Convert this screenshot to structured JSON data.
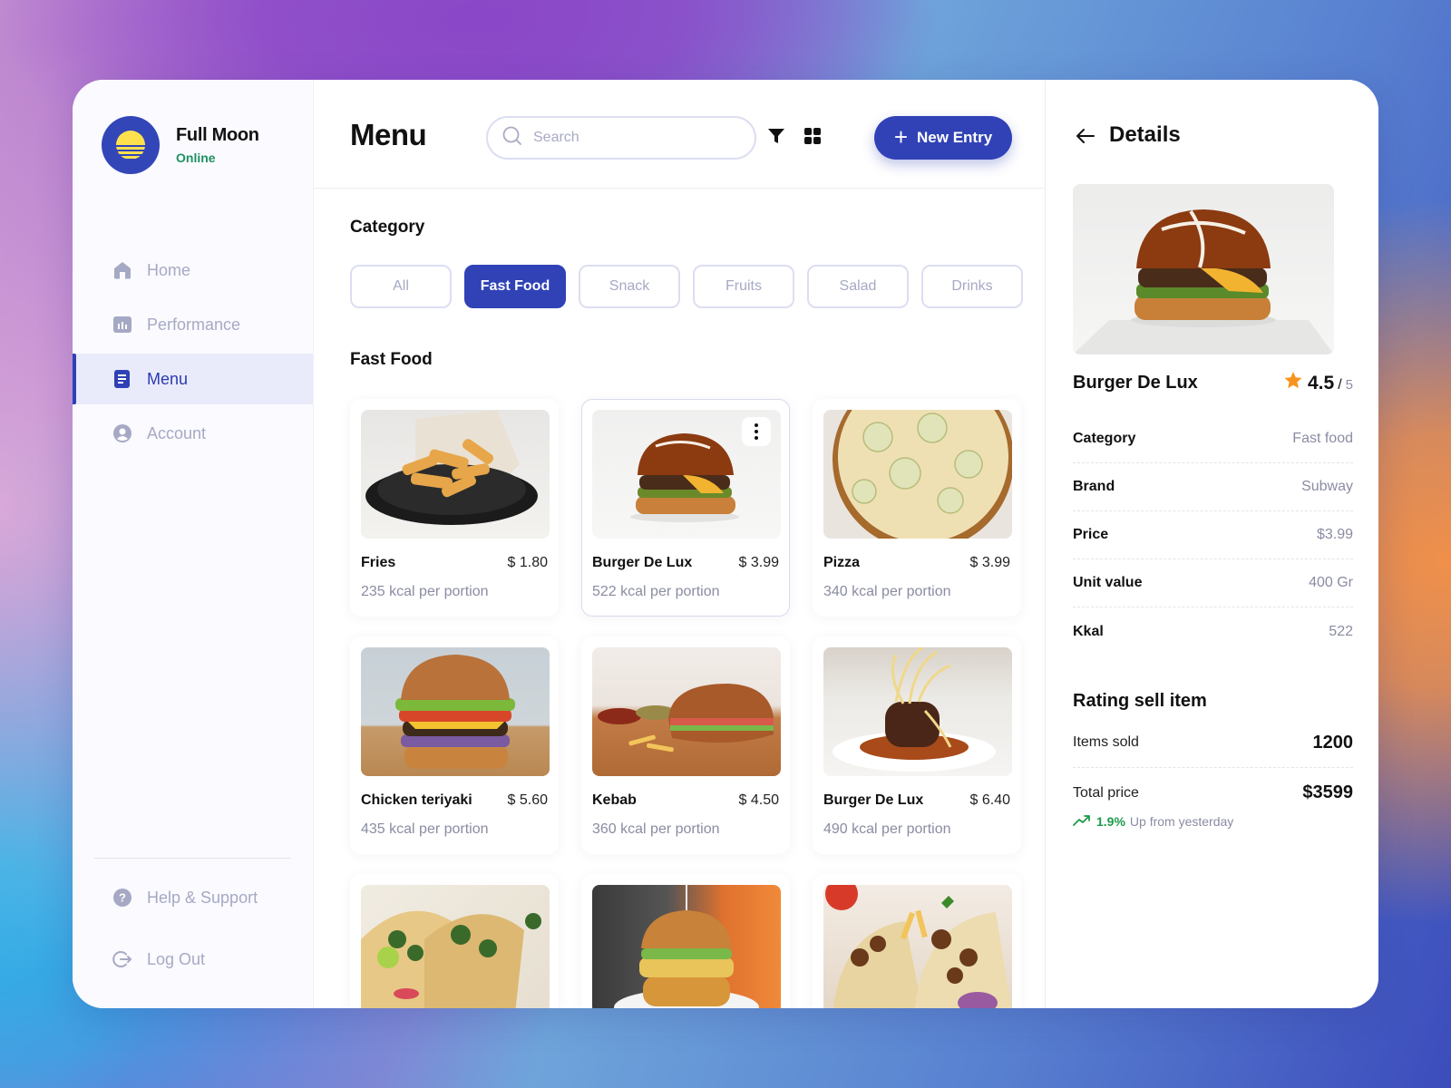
{
  "brand": {
    "name": "Full Moon",
    "status": "Online"
  },
  "sidebar": {
    "items": [
      {
        "label": "Home",
        "icon": "home-icon",
        "active": false
      },
      {
        "label": "Performance",
        "icon": "chart-icon",
        "active": false
      },
      {
        "label": "Menu",
        "icon": "document-icon",
        "active": true
      },
      {
        "label": "Account",
        "icon": "user-icon",
        "active": false
      }
    ],
    "bottom": [
      {
        "label": "Help & Support",
        "icon": "help-icon"
      },
      {
        "label": "Log Out",
        "icon": "logout-icon"
      }
    ]
  },
  "header": {
    "title": "Menu",
    "search_placeholder": "Search",
    "search_value": "",
    "new_entry_label": "New Entry"
  },
  "category": {
    "title": "Category",
    "chips": [
      {
        "label": "All",
        "active": false
      },
      {
        "label": "Fast Food",
        "active": true
      },
      {
        "label": "Snack",
        "active": false
      },
      {
        "label": "Fruits",
        "active": false
      },
      {
        "label": "Salad",
        "active": false
      },
      {
        "label": "Drinks",
        "active": false
      }
    ]
  },
  "listing": {
    "title": "Fast Food",
    "items": [
      {
        "name": "Fries",
        "price": "$ 1.80",
        "kcal": "235 kcal per portion",
        "image": "fries"
      },
      {
        "name": "Burger De Lux",
        "price": "$ 3.99",
        "kcal": "522 kcal per portion",
        "image": "pretzel-burger",
        "selected": true
      },
      {
        "name": "Pizza",
        "price": "$ 3.99",
        "kcal": "340 kcal per portion",
        "image": "pizza"
      },
      {
        "name": "Chicken teriyaki",
        "price": "$ 5.60",
        "kcal": "435 kcal per portion",
        "image": "sesame-burger"
      },
      {
        "name": "Kebab",
        "price": "$ 4.50",
        "kcal": "360 kcal per portion",
        "image": "kebab-sandwich"
      },
      {
        "name": "Burger De Lux",
        "price": "$ 6.40",
        "kcal": "490 kcal per portion",
        "image": "steak-dish"
      },
      {
        "name": "",
        "price": "",
        "kcal": "",
        "image": "tacos"
      },
      {
        "name": "",
        "price": "",
        "kcal": "",
        "image": "burger"
      },
      {
        "name": "",
        "price": "",
        "kcal": "",
        "image": "gyro"
      }
    ]
  },
  "details": {
    "title": "Details",
    "item_name": "Burger De Lux",
    "rating": "4.5",
    "rating_max": "5",
    "rating_color": "#f7941d",
    "info": [
      {
        "key": "Category",
        "value": "Fast food"
      },
      {
        "key": "Brand",
        "value": "Subway"
      },
      {
        "key": "Price",
        "value": "$3.99"
      },
      {
        "key": "Unit value",
        "value": "400 Gr"
      },
      {
        "key": "Kkal",
        "value": "522"
      }
    ],
    "stats_title": "Rating sell item",
    "items_sold_label": "Items sold",
    "items_sold": "1200",
    "total_price_label": "Total price",
    "total_price": "$3599",
    "trend_pct": "1.9%",
    "trend_text": "Up from yesterday",
    "trend_color": "#1d9a4a"
  },
  "colors": {
    "accent": "#3042b6",
    "muted": "#a6a9c4",
    "logo_sun": "#ffe14d"
  }
}
